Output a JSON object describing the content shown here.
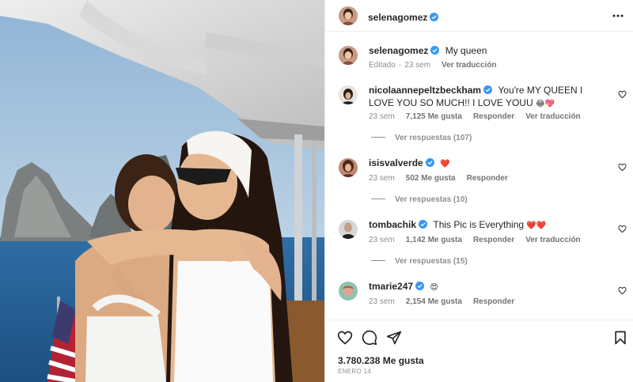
{
  "post": {
    "author": "selenagomez",
    "more_icon": "more-horizontal-icon"
  },
  "caption": {
    "author": "selenagomez",
    "text": "My queen",
    "edited": "Editado",
    "time": "23 sem",
    "translate": "Ver traducción"
  },
  "comments": [
    {
      "user": "nicolaannepeltzbeckham",
      "text": "You're MY QUEEN I LOVE YOU SO MUCH!! I LOVE YOUU ",
      "emoji": "😂💖",
      "time": "23 sem",
      "likes": "7,125 Me gusta",
      "reply": "Responder",
      "translate": "Ver traducción",
      "replies": "Ver respuestas (107)"
    },
    {
      "user": "isisvalverde",
      "text": "",
      "emoji": "❤️",
      "time": "23 sem",
      "likes": "502 Me gusta",
      "reply": "Responder",
      "replies": "Ver respuestas (10)"
    },
    {
      "user": "tombachik",
      "text": "This Pic is Everything ",
      "emoji": "❤️❤️",
      "time": "23 sem",
      "likes": "1,142 Me gusta",
      "reply": "Responder",
      "translate": "Ver traducción",
      "replies": "Ver respuestas (15)"
    },
    {
      "user": "tmarie247",
      "text": "",
      "emoji": "😍",
      "time": "23 sem",
      "likes": "2,154 Me gusta",
      "reply": "Responder"
    }
  ],
  "footer": {
    "likes": "3.780.238 Me gusta",
    "date": "ENERO 14"
  },
  "colors": {
    "verified": "#3897f0",
    "text": "#262626",
    "muted": "#8e8e8e",
    "heart_red": "#ed4956"
  }
}
